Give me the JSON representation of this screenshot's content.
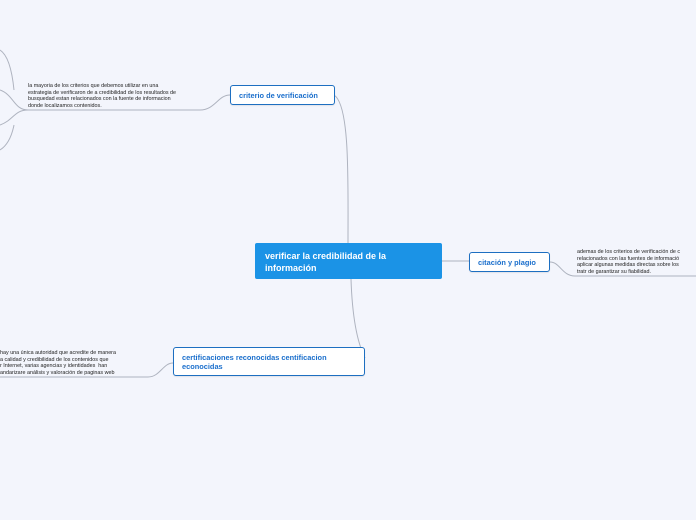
{
  "colors": {
    "background": "#f3f5fc",
    "central": "#1b93e6",
    "topic_border": "#1d6fc1",
    "topic_text": "#1b6fcc",
    "link": "#aeb3bf"
  },
  "central": {
    "label": "verificar la credibilidad de la información"
  },
  "topics": [
    {
      "label": "criterio de verificación",
      "note": "la mayoria de los criterios que debemos utilizar en una\nestrategia de verificaron de a credibilidad de los resultados de\nbusquedad  estan relacionados con la fuente de informacion\ndonde localizamos contenidos."
    },
    {
      "label": "citación y plagio",
      "note": "ademas de los criterios de verificación de c\nrelacionados con las fuentes de informació\naplicar algunas medidas directas sobre los\ntratr de garantizar su fiabilidad."
    },
    {
      "label": "certificaciones reconocidas centificacion econocidas",
      "note": "hay una única autoridad que acredite de manera\na calidad y credibilidad de los contenidos que\nr Internet, varias agencias y identidades  han\nandarizare análisis y valoración de paginas web"
    }
  ]
}
